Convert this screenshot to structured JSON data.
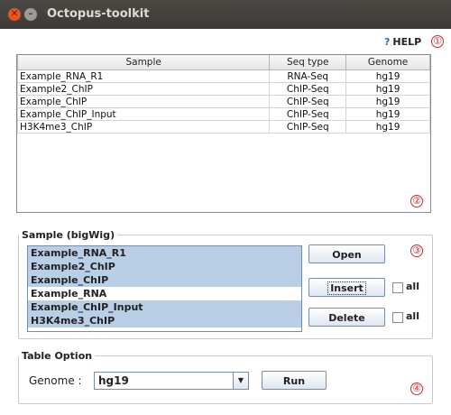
{
  "window": {
    "title": "Octopus-toolkit"
  },
  "help": {
    "label": "HELP",
    "icon": "question-icon"
  },
  "markers": [
    "①",
    "②",
    "③",
    "④"
  ],
  "table": {
    "headers": [
      "Sample",
      "Seq type",
      "Genome"
    ],
    "rows": [
      [
        "Example_RNA_R1",
        "RNA-Seq",
        "hg19"
      ],
      [
        "Example2_ChIP",
        "ChIP-Seq",
        "hg19"
      ],
      [
        "Example_ChIP",
        "ChIP-Seq",
        "hg19"
      ],
      [
        "Example_ChIP_Input",
        "ChIP-Seq",
        "hg19"
      ],
      [
        "H3K4me3_ChIP",
        "ChIP-Seq",
        "hg19"
      ]
    ]
  },
  "sample_panel": {
    "legend": "Sample (bigWig)",
    "items": [
      "Example_RNA_R1",
      "Example2_ChIP",
      "Example_ChIP",
      "Example_RNA",
      "Example_ChIP_Input",
      "H3K4me3_ChIP"
    ],
    "open_label": "Open",
    "insert_label": "Insert",
    "delete_label": "Delete",
    "all_label": "all"
  },
  "table_option": {
    "legend": "Table Option",
    "genome_label": "Genome :",
    "genome_value": "hg19",
    "run_label": "Run"
  }
}
